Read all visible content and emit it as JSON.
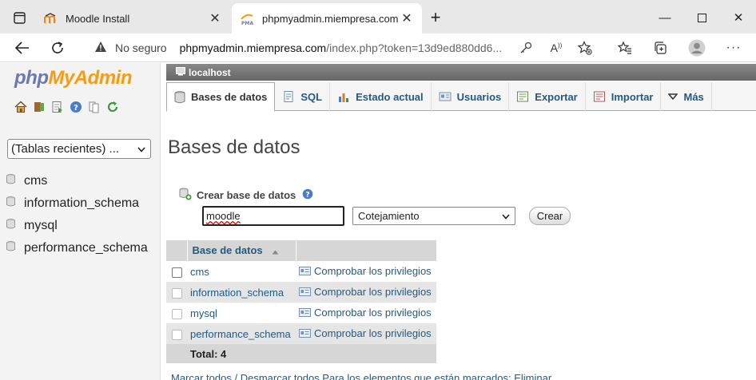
{
  "browser": {
    "tabs": [
      {
        "title": "Moodle Install"
      },
      {
        "title": "phpmyadmin.miempresa.com / l"
      }
    ],
    "url": {
      "security_label": "No seguro",
      "host": "phpmyadmin.miempresa.com",
      "path": "/index.php?token=13d9ed880dd6..."
    }
  },
  "pma": {
    "logo": {
      "php": "php",
      "myadmin": "MyAdmin"
    },
    "recent_tables": "(Tablas recientes) ...",
    "nav_databases": [
      "cms",
      "information_schema",
      "mysql",
      "performance_schema"
    ],
    "server": "localhost",
    "menu": {
      "databases": "Bases de datos",
      "sql": "SQL",
      "status": "Estado actual",
      "users": "Usuarios",
      "export": "Exportar",
      "import": "Importar",
      "more": "Más"
    },
    "page_title": "Bases de datos",
    "create": {
      "label": "Crear base de datos",
      "db_name_value": "moodle",
      "collation_selected": "Cotejamiento",
      "button": "Crear"
    },
    "table": {
      "header": "Base de datos",
      "rows": [
        {
          "name": "cms",
          "action": "Comprobar los privilegios"
        },
        {
          "name": "information_schema",
          "action": "Comprobar los privilegios"
        },
        {
          "name": "mysql",
          "action": "Comprobar los privilegios"
        },
        {
          "name": "performance_schema",
          "action": "Comprobar los privilegios"
        }
      ],
      "total": "Total: 4"
    },
    "bottom_text": "Marcar todos / Desmarcar todos   Para los elementos que están marcados:   Eliminar"
  },
  "colors": {
    "link": "#235a81",
    "logo_php": "#6c78af",
    "logo_myadmin": "#f89c0e"
  }
}
